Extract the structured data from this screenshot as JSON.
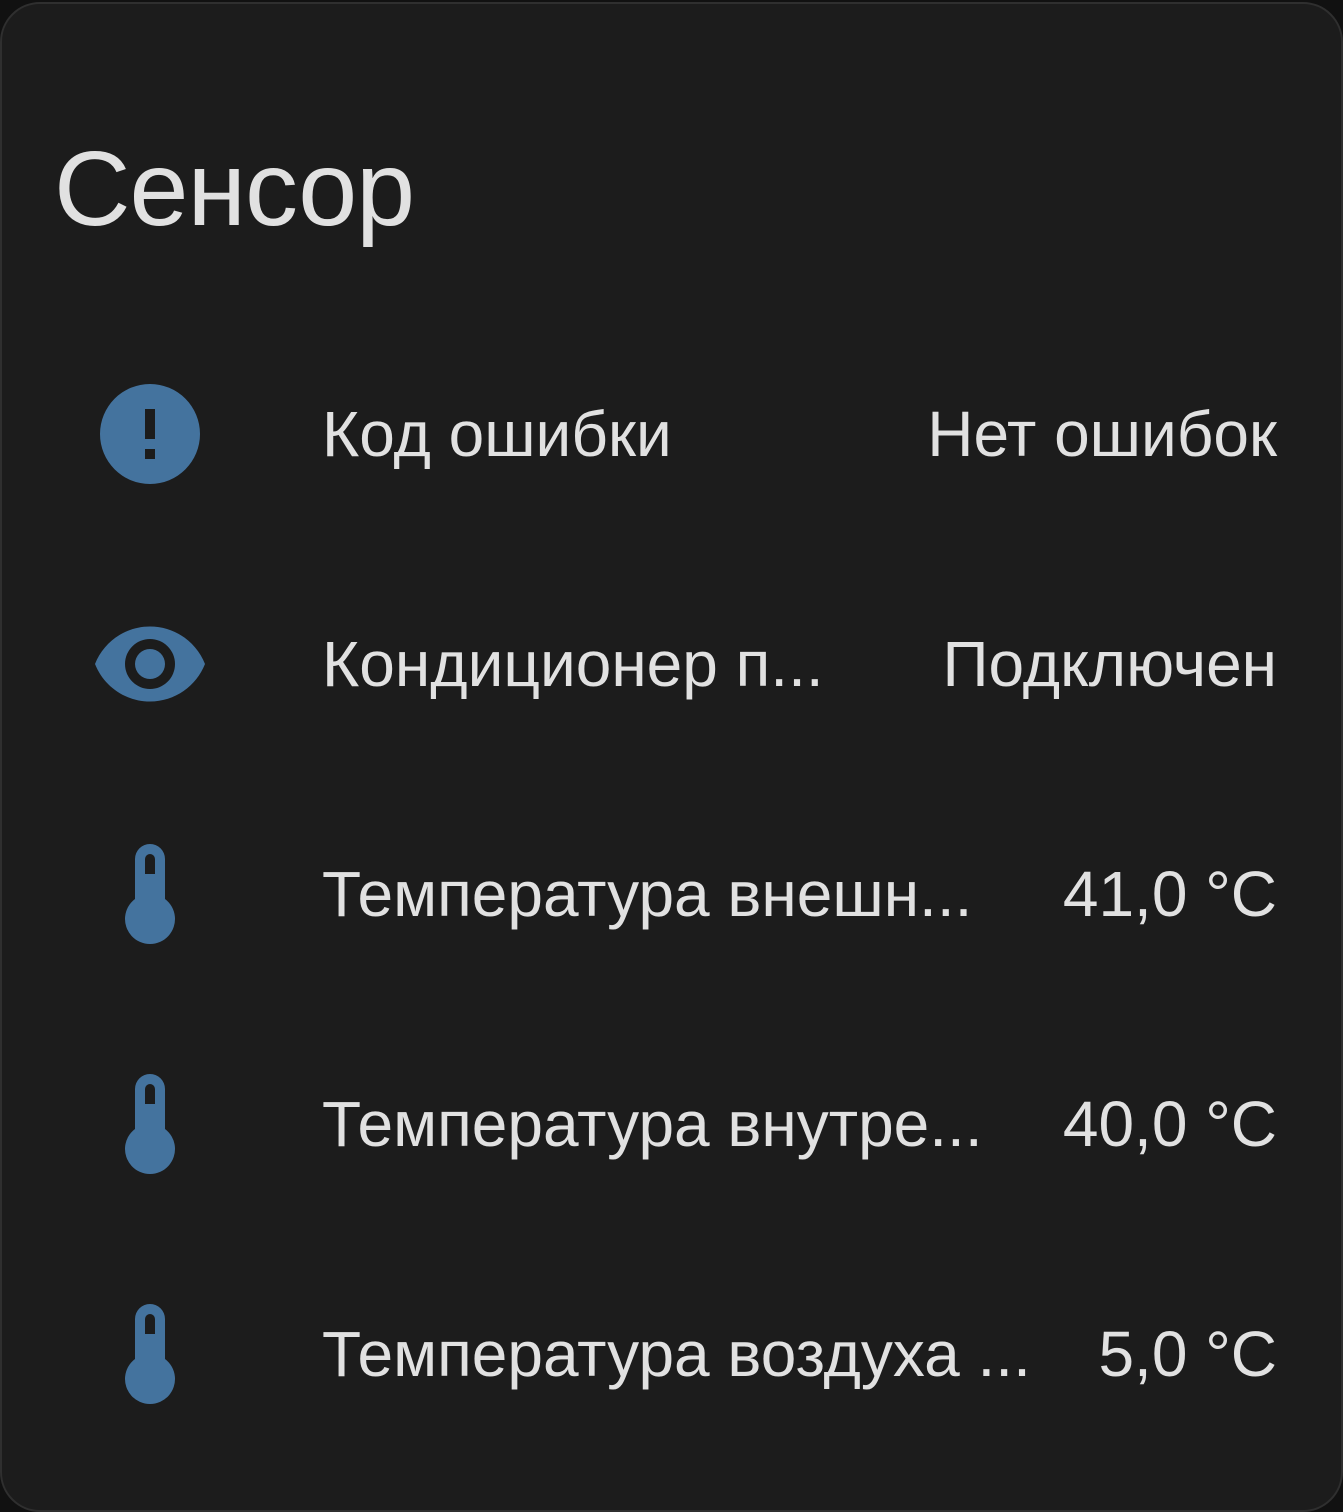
{
  "card": {
    "title": "Сенсор"
  },
  "colors": {
    "background": "#1c1c1c",
    "icon": "#44739e",
    "text": "#e1e1e1"
  },
  "entities": [
    {
      "icon": "alert-circle-icon",
      "name": "Код ошибки",
      "state": "Нет ошибок"
    },
    {
      "icon": "eye-icon",
      "name": "Кондиционер п...",
      "state": "Подключен"
    },
    {
      "icon": "thermometer-icon",
      "name": "Температура внешн...",
      "state": "41,0 °C"
    },
    {
      "icon": "thermometer-icon",
      "name": "Температура внутре...",
      "state": "40,0 °C"
    },
    {
      "icon": "thermometer-icon",
      "name": "Температура воздуха ...",
      "state": "5,0 °C"
    }
  ]
}
